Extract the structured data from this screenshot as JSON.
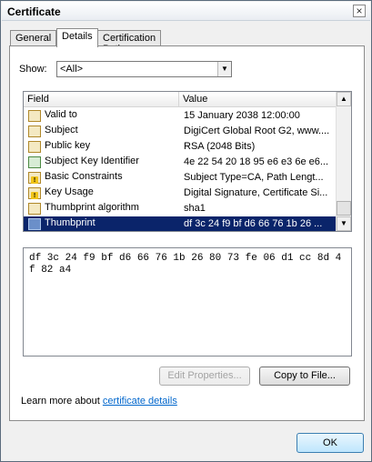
{
  "window": {
    "title": "Certificate"
  },
  "tabs": [
    {
      "label": "General"
    },
    {
      "label": "Details"
    },
    {
      "label": "Certification Path"
    }
  ],
  "show": {
    "label": "Show:",
    "selected": "<All>"
  },
  "list": {
    "columns": [
      "Field",
      "Value"
    ],
    "rows": [
      {
        "icon": "certificate-field-icon",
        "field": "Valid to",
        "value": "15 January 2038 12:00:00"
      },
      {
        "icon": "certificate-field-icon",
        "field": "Subject",
        "value": "DigiCert Global Root G2, www...."
      },
      {
        "icon": "certificate-field-icon",
        "field": "Public key",
        "value": "RSA (2048 Bits)"
      },
      {
        "icon": "key-identifier-icon",
        "field": "Subject Key Identifier",
        "value": "4e 22 54 20 18 95 e6 e3 6e e6..."
      },
      {
        "icon": "critical-extension-icon",
        "field": "Basic Constraints",
        "value": "Subject Type=CA, Path Lengt..."
      },
      {
        "icon": "critical-extension-icon",
        "field": "Key Usage",
        "value": "Digital Signature, Certificate Si..."
      },
      {
        "icon": "certificate-field-icon",
        "field": "Thumbprint algorithm",
        "value": "sha1"
      },
      {
        "icon": "certificate-field-icon",
        "field": "Thumbprint",
        "value": "df 3c 24 f9 bf d6 66 76 1b 26 ..."
      }
    ],
    "selected_index": 7
  },
  "detail_text": "df 3c 24 f9 bf d6 66 76 1b 26 80 73 fe 06 d1 cc 8d 4f 82 a4",
  "buttons": {
    "edit_properties": "Edit Properties...",
    "copy_to_file": "Copy to File...",
    "ok": "OK"
  },
  "learn_more": {
    "prefix": "Learn more about ",
    "link": "certificate details"
  }
}
